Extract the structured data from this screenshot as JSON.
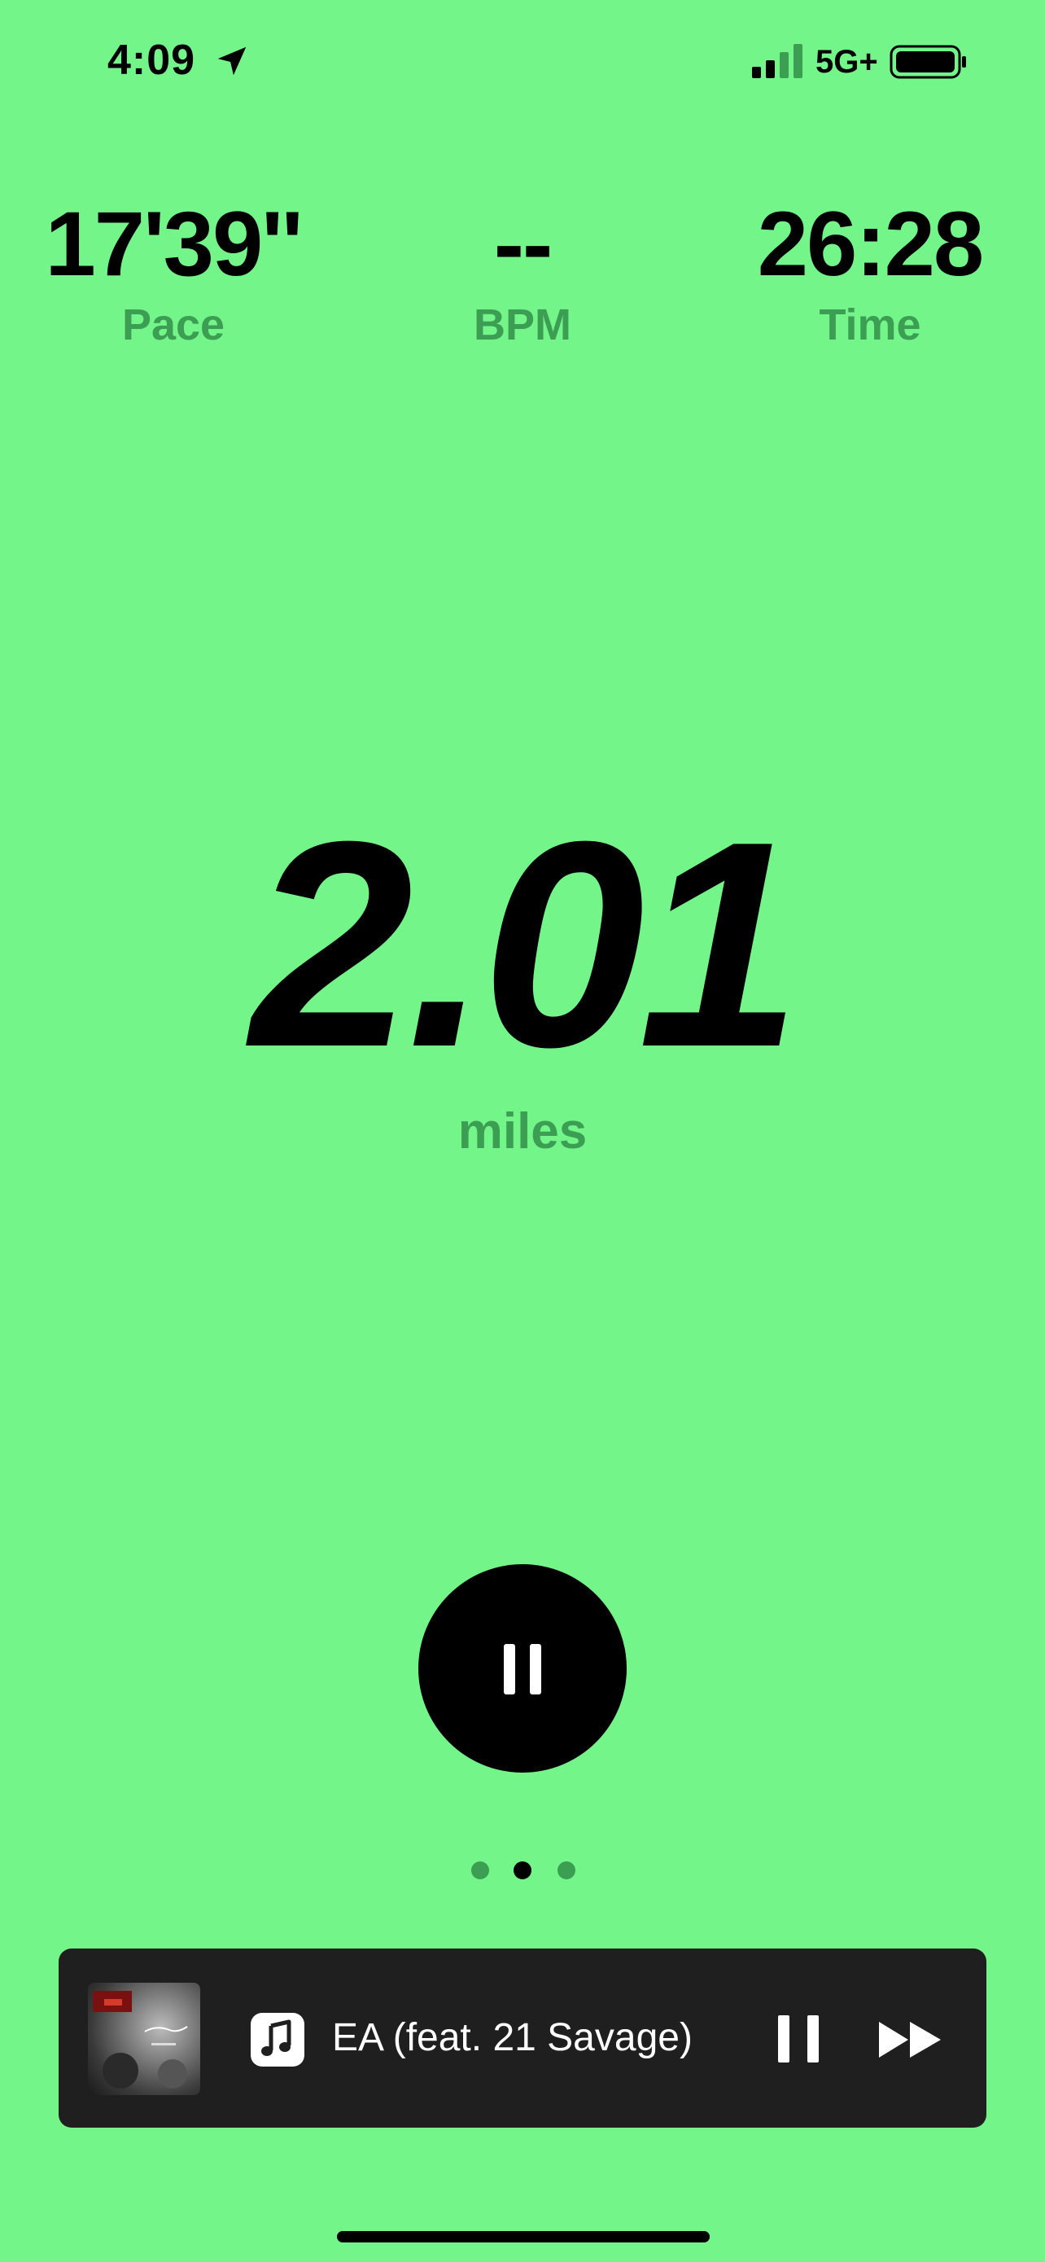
{
  "colors": {
    "background": "#73F58A",
    "label_green": "#3B9E53",
    "player_background": "#1F1F1F"
  },
  "status_bar": {
    "time": "4:09",
    "network": "5G+",
    "location_icon": "location-arrow-icon",
    "signal_icon": "cellular-signal-icon",
    "battery_icon": "battery-icon"
  },
  "metrics": {
    "pace": {
      "value": "17'39''",
      "label": "Pace"
    },
    "bpm": {
      "value": "--",
      "label": "BPM"
    },
    "time": {
      "value": "26:28",
      "label": "Time"
    }
  },
  "distance": {
    "value": "2.01",
    "unit": "miles"
  },
  "controls": {
    "pause_icon": "pause-icon"
  },
  "pager": {
    "count": 3,
    "active_index": 1
  },
  "now_playing": {
    "title": "EA (feat. 21 Savage)",
    "app_icon": "music-note-icon",
    "pause_icon": "pause-icon",
    "next_icon": "fast-forward-icon"
  }
}
